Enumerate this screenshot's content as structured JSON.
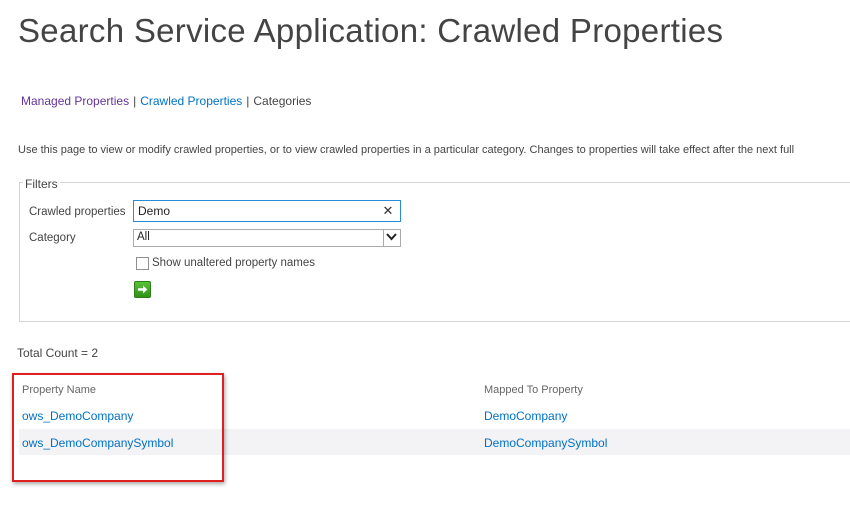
{
  "page": {
    "title": "Search Service Application: Crawled Properties",
    "description": "Use this page to view or modify crawled properties, or to view crawled properties in a particular category. Changes to properties will take effect after the next full"
  },
  "nav": {
    "managed_properties": "Managed Properties",
    "separator": "|",
    "crawled_properties": "Crawled Properties",
    "categories": "Categories"
  },
  "filters": {
    "legend": "Filters",
    "crawled_properties_label": "Crawled properties",
    "crawled_properties_value": "Demo",
    "clear_glyph": "✕",
    "category_label": "Category",
    "category_selected": "All",
    "show_unaltered_label": "Show unaltered property names",
    "show_unaltered_checked": false
  },
  "results": {
    "total_count": "Total Count = 2",
    "columns": {
      "property_name": "Property Name",
      "mapped_to": "Mapped To Property"
    },
    "rows": [
      {
        "property_name": "ows_DemoCompany",
        "mapped_to": "DemoCompany"
      },
      {
        "property_name": "ows_DemoCompanySymbol",
        "mapped_to": "DemoCompanySymbol"
      }
    ]
  },
  "colors": {
    "link": "#0072c6",
    "visited_link": "#663399",
    "highlight": "#e02020",
    "go_button": "#3ea521"
  },
  "icons": {
    "clear": "close-icon",
    "dropdown": "chevron-down-icon",
    "go": "arrow-right-icon"
  }
}
